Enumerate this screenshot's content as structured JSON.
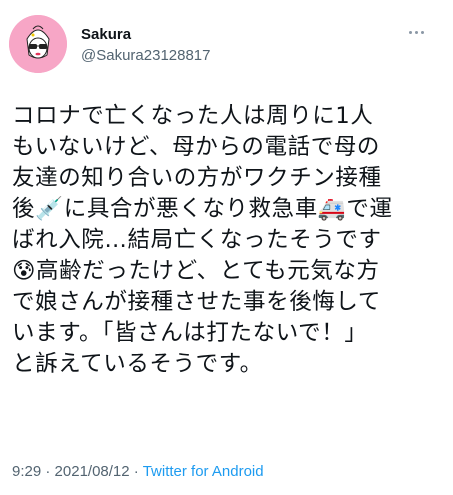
{
  "user": {
    "display_name": "Sakura",
    "handle": "@Sakura23128817"
  },
  "tweet": {
    "lines": [
      "コロナで亡くなった人は周りに1人",
      "もいないけど、母からの電話で母の",
      "友達の知り合いの方がワクチン接種",
      "後💉に具合が悪くなり救急車🚑で運",
      "ばれ入院…結局亡くなったそうです",
      "😰高齢だったけど、とても元気な方",
      "で娘さんが接種させた事を後悔して",
      "います。「皆さんは打たないで！」",
      "と訴えているそうです。"
    ]
  },
  "meta": {
    "time": "9:29",
    "separator": "·",
    "date": "2021/08/12",
    "source": "Twitter for Android"
  },
  "icons": {
    "more": "more-options-icon"
  }
}
